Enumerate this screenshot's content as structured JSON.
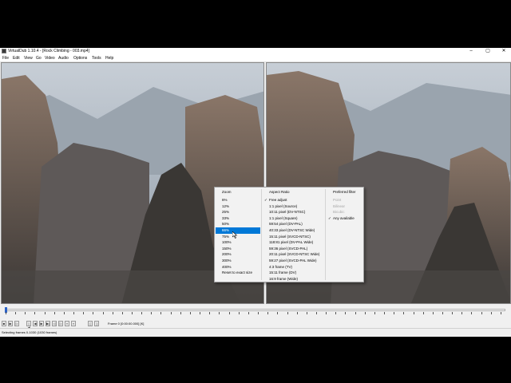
{
  "window": {
    "title": "VirtualDub 1.10.4 - [Rock Climbing - 003.mp4]",
    "minimize_icon": "minimize-icon",
    "maximize_icon": "maximize-icon",
    "close_icon": "close-icon"
  },
  "menu": [
    "File",
    "Edit",
    "View",
    "Go",
    "Video",
    "Audio",
    "Options",
    "Tools",
    "Help"
  ],
  "context_menu": {
    "zoom": {
      "header": "Zoom",
      "items": [
        "6%",
        "12%",
        "25%",
        "33%",
        "50%",
        "66%",
        "75%",
        "100%",
        "150%",
        "200%",
        "300%",
        "400%",
        "Reset to exact size"
      ],
      "selected": "66%"
    },
    "aspect_ratio": {
      "header": "Aspect Ratio",
      "items": [
        "Free adjust",
        "1:1 pixel (Source)",
        "10:11 pixel (DV-NTSC)",
        "1:1 pixel (Square)",
        "59:54 pixel (DV-PAL)",
        "40:33 pixel (DV-NTSC Wide)",
        "15:11 pixel (SVCD-NTSC)",
        "118:81 pixel (DV-PAL Wide)",
        "59:36 pixel (SVCD-PAL)",
        "20:11 pixel (SVCD-NTSC Wide)",
        "59:27 pixel (SVCD-PAL Wide)",
        "4:3 frame (TV)",
        "15:11 frame (DV)",
        "16:9 frame (Wide)"
      ],
      "checked": "Free adjust"
    },
    "preferred_filter": {
      "header": "Preferred filter",
      "items": [
        "Point",
        "Bilinear",
        "Bicubic",
        "Any available"
      ],
      "checked": "Any available"
    }
  },
  "timeline": {
    "tick_labels": [
      "0",
      "20",
      "40",
      "60",
      "80",
      "100",
      "120",
      "140",
      "160",
      "180",
      "200",
      "220",
      "240",
      "260",
      "280",
      "300",
      "320",
      "340",
      "360",
      "380",
      "400",
      "420",
      "440",
      "460",
      "480",
      "500",
      "520",
      "540",
      "560",
      "580",
      "600",
      "620",
      "640",
      "660",
      "680",
      "700",
      "720",
      "740",
      "760",
      "780",
      "800",
      "820",
      "840",
      "860",
      "880",
      "900",
      "920",
      "940",
      "960",
      "980",
      "1000",
      "1020"
    ],
    "position": 0,
    "max": 1030
  },
  "toolbar": {
    "buttons": [
      "stop-icon",
      "play-input-icon",
      "play-output-icon",
      "start-icon",
      "prev-frame-icon",
      "next-frame-icon",
      "end-icon",
      "prev-key-icon",
      "next-key-icon",
      "prev-scene-icon",
      "next-scene-icon",
      "mark-in-icon",
      "mark-out-icon"
    ],
    "frame_text": "Frame 0 [0:00:00.000] [K]"
  },
  "status": {
    "text": "Selecting frames 0-1030 (1030 frames)"
  },
  "colors": {
    "selection": "#0078d7",
    "window_bg": "#f0f0f0",
    "sky": "#a9b4bf",
    "rock": "#6e6561"
  }
}
